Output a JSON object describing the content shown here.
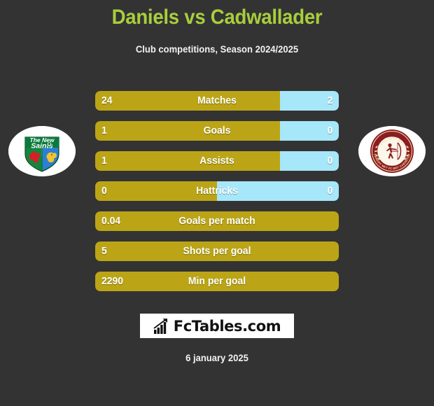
{
  "header": {
    "title": "Daniels vs Cadwallader",
    "subtitle": "Club competitions, Season 2024/2025",
    "title_color": "#A8CE3C"
  },
  "colors": {
    "background": "#333333",
    "home_bar": "#BBA517",
    "away_bar": "#A7E7FA",
    "text": "#FFFFFF"
  },
  "teams": {
    "home": {
      "name": "The New Saints",
      "crest_lines": [
        "The New",
        "Saints"
      ]
    },
    "away": {
      "name": "Cardiff Met FC",
      "crest_lines": [
        "Caerdydd Met",
        "CARDIFF MET FC MET CAERDYDD"
      ]
    }
  },
  "stats": [
    {
      "label": "Matches",
      "home": "24",
      "away": "2",
      "home_pct": 76,
      "away_pct": 24,
      "split": true
    },
    {
      "label": "Goals",
      "home": "1",
      "away": "0",
      "home_pct": 76,
      "away_pct": 24,
      "split": true
    },
    {
      "label": "Assists",
      "home": "1",
      "away": "0",
      "home_pct": 76,
      "away_pct": 24,
      "split": true
    },
    {
      "label": "Hattricks",
      "home": "0",
      "away": "0",
      "home_pct": 50,
      "away_pct": 50,
      "split": true
    },
    {
      "label": "Goals per match",
      "home": "0.04",
      "away": "",
      "home_pct": 100,
      "away_pct": 0,
      "split": false
    },
    {
      "label": "Shots per goal",
      "home": "5",
      "away": "",
      "home_pct": 100,
      "away_pct": 0,
      "split": false
    },
    {
      "label": "Min per goal",
      "home": "2290",
      "away": "",
      "home_pct": 100,
      "away_pct": 0,
      "split": false
    }
  ],
  "footer": {
    "logo_text": "FcTables.com",
    "logo_icon": "bar-chart-up-icon",
    "date": "6 january 2025"
  }
}
